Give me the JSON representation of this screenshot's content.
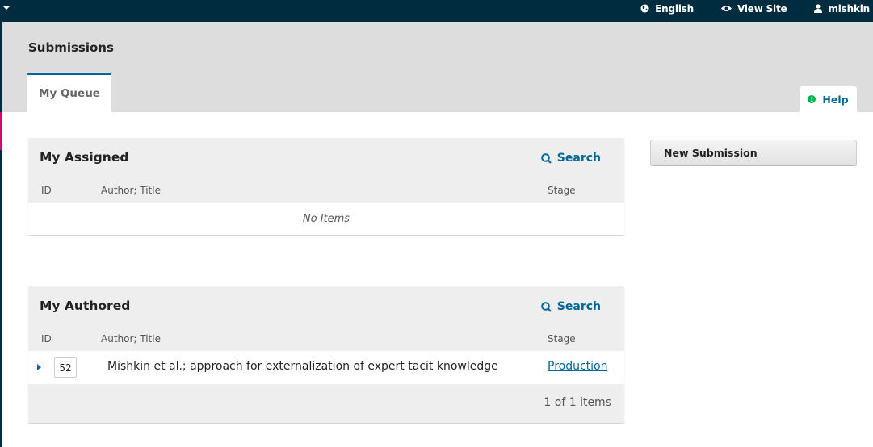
{
  "topbar": {
    "links": [
      {
        "icon": "globe-icon",
        "label": "English"
      },
      {
        "icon": "eye-icon",
        "label": "View Site"
      },
      {
        "icon": "user-icon",
        "label": "mishkin"
      }
    ]
  },
  "colors": {
    "topbar": "#002c40",
    "accent": "#006798",
    "nav_indicator": "#d00a6c",
    "help_icon": "#00b24e"
  },
  "header": {
    "title": "Submissions",
    "tabs": [
      {
        "label": "My Queue",
        "active": true
      }
    ],
    "help_label": "Help"
  },
  "sidebar_actions": {
    "new_submission_label": "New Submission"
  },
  "panels": {
    "assigned": {
      "title": "My Assigned",
      "search_label": "Search",
      "columns": [
        "ID",
        "Author; Title",
        "Stage"
      ],
      "empty_text": "No Items"
    },
    "authored": {
      "title": "My Authored",
      "search_label": "Search",
      "columns": [
        "ID",
        "Author; Title",
        "Stage"
      ],
      "rows": [
        {
          "id": "52",
          "title": "Mishkin et al.; approach for externalization of expert tacit knowledge",
          "stage": "Production"
        }
      ],
      "pagination": "1 of 1 items"
    }
  }
}
